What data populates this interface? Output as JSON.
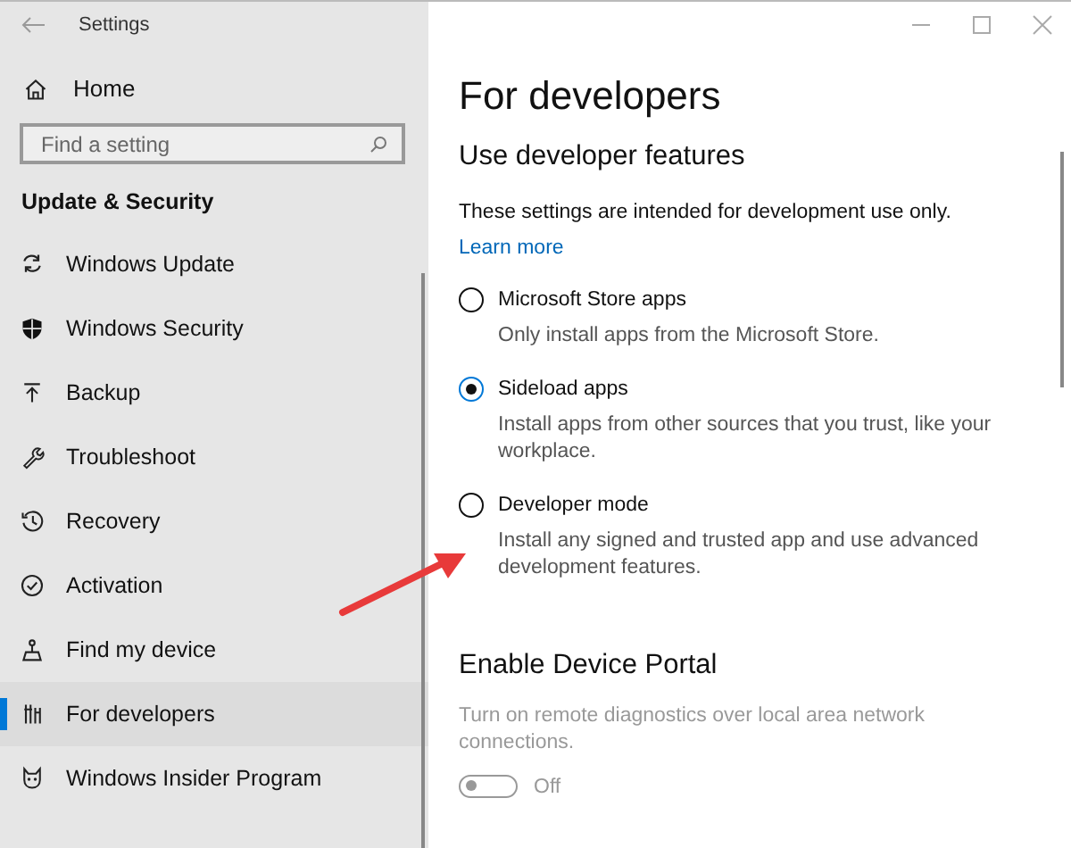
{
  "window": {
    "title": "Settings"
  },
  "sidebar": {
    "home": "Home",
    "search": {
      "placeholder": "Find a setting"
    },
    "section": "Update & Security",
    "items": [
      {
        "label": "Windows Update",
        "selected": false
      },
      {
        "label": "Windows Security",
        "selected": false
      },
      {
        "label": "Backup",
        "selected": false
      },
      {
        "label": "Troubleshoot",
        "selected": false
      },
      {
        "label": "Recovery",
        "selected": false
      },
      {
        "label": "Activation",
        "selected": false
      },
      {
        "label": "Find my device",
        "selected": false
      },
      {
        "label": "For developers",
        "selected": true
      },
      {
        "label": "Windows Insider Program",
        "selected": false
      }
    ]
  },
  "page": {
    "title": "For developers",
    "heading": "Use developer features",
    "intro": "These settings are intended for development use only.",
    "link": "Learn more",
    "options": [
      {
        "label": "Microsoft Store apps",
        "description": "Only install apps from the Microsoft Store.",
        "selected": false
      },
      {
        "label": "Sideload apps",
        "description": "Install apps from other sources that you trust, like your workplace.",
        "selected": true
      },
      {
        "label": "Developer mode",
        "description": "Install any signed and trusted app and use advanced development features.",
        "selected": false
      }
    ],
    "portal": {
      "heading": "Enable Device Portal",
      "description": "Turn on remote diagnostics over local area network connections.",
      "toggle": {
        "on": false,
        "disabled": true,
        "label": "Off"
      }
    }
  }
}
